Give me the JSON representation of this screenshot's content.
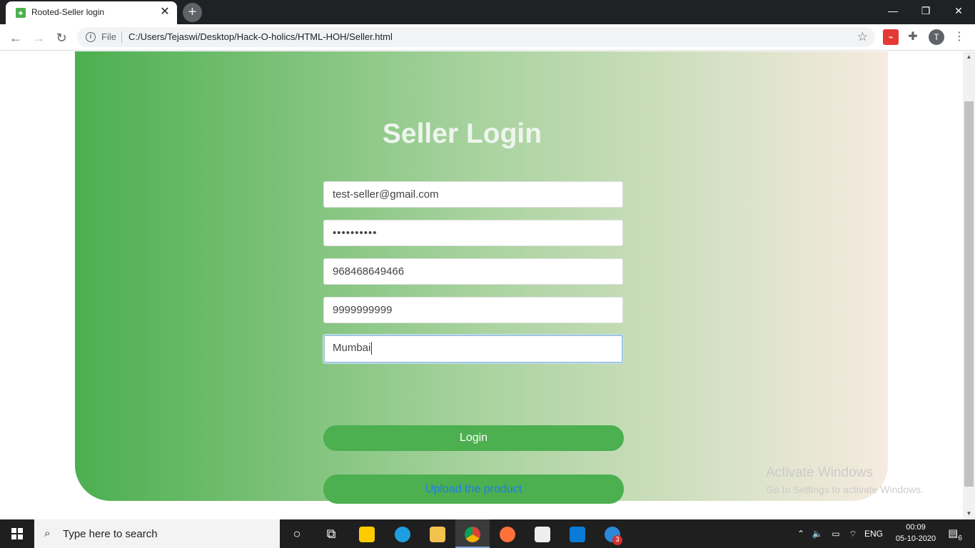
{
  "browser": {
    "tab_title": "Rooted-Seller login",
    "tab_close": "✕",
    "new_tab": "+",
    "url_scheme": "File",
    "url": "C:/Users/Tejaswi/Desktop/Hack-O-holics/HTML-HOH/Seller.html",
    "profile_initial": "T",
    "minimize": "—",
    "restore": "❐",
    "close": "✕"
  },
  "page": {
    "title": "Seller Login",
    "email_value": "test-seller@gmail.com",
    "password_masked": "••••••••••",
    "phone_value": "968468649466",
    "alt_phone_value": "9999999999",
    "city_value": "Mumbai",
    "login_label": "Login",
    "upload_label": "Upload the product"
  },
  "watermark": {
    "line1": "Activate Windows",
    "line2": "Go to Settings to activate Windows."
  },
  "taskbar": {
    "search_placeholder": "Type here to search",
    "language": "ENG",
    "time": "00:09",
    "date": "05-10-2020",
    "notification_count": "6",
    "app_badge": "3"
  },
  "colors": {
    "accent_green": "#4caf50",
    "link_blue": "#1a7cf5"
  }
}
